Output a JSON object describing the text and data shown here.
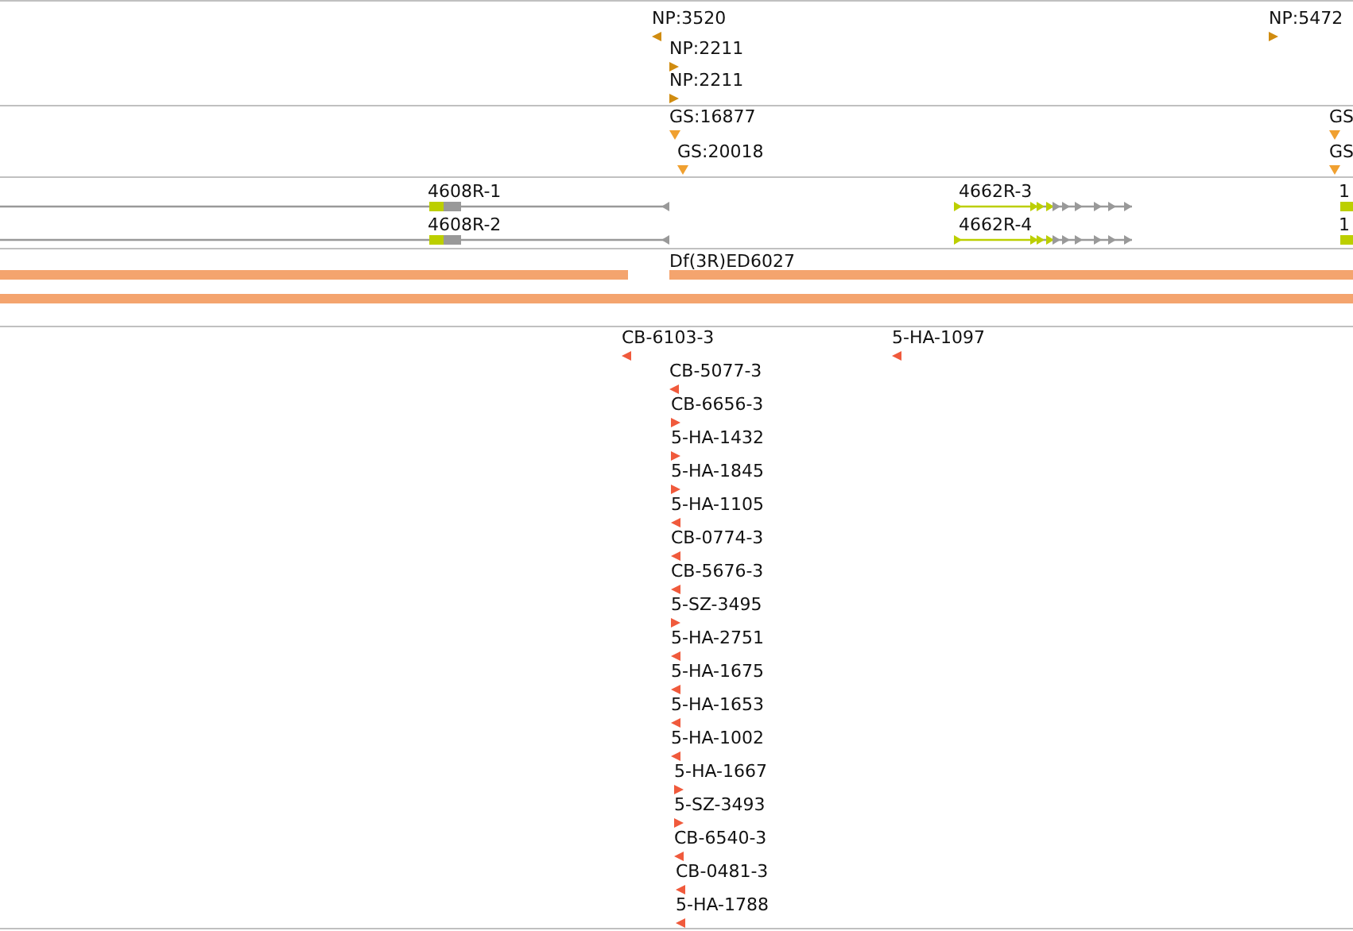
{
  "tracks": {
    "np": [
      {
        "label": "NP:3520",
        "kind": "reverse"
      },
      {
        "label": "NP:2211",
        "kind": "forward"
      },
      {
        "label": "NP:2211",
        "kind": "forward"
      },
      {
        "label": "NP:5472",
        "kind": "forward"
      }
    ],
    "gs": [
      {
        "label": "GS:16877",
        "kind": "down"
      },
      {
        "label": "GS:20018",
        "kind": "down"
      },
      {
        "label": "GS",
        "kind": "down"
      },
      {
        "label": "GS",
        "kind": "down"
      }
    ],
    "transcripts": [
      {
        "label": "4608R-1",
        "kind": "reverse"
      },
      {
        "label": "4608R-2",
        "kind": "reverse"
      },
      {
        "label": "4662R-3",
        "kind": "forward"
      },
      {
        "label": "4662R-4",
        "kind": "forward"
      },
      {
        "label": "1",
        "kind": "forward"
      },
      {
        "label": "1",
        "kind": "forward"
      }
    ],
    "deficiency": {
      "label": "Df(3R)ED6027"
    },
    "insertions": [
      {
        "label": "CB-6103-3",
        "kind": "reverse"
      },
      {
        "label": "5-HA-1097",
        "kind": "reverse"
      },
      {
        "label": "CB-5077-3",
        "kind": "reverse"
      },
      {
        "label": "CB-6656-3",
        "kind": "forward"
      },
      {
        "label": "5-HA-1432",
        "kind": "forward"
      },
      {
        "label": "5-HA-1845",
        "kind": "forward"
      },
      {
        "label": "5-HA-1105",
        "kind": "reverse"
      },
      {
        "label": "CB-0774-3",
        "kind": "reverse"
      },
      {
        "label": "CB-5676-3",
        "kind": "reverse"
      },
      {
        "label": "5-SZ-3495",
        "kind": "forward"
      },
      {
        "label": "5-HA-2751",
        "kind": "reverse"
      },
      {
        "label": "5-HA-1675",
        "kind": "reverse"
      },
      {
        "label": "5-HA-1653",
        "kind": "reverse"
      },
      {
        "label": "5-HA-1002",
        "kind": "reverse"
      },
      {
        "label": "5-HA-1667",
        "kind": "forward"
      },
      {
        "label": "5-SZ-3493",
        "kind": "forward"
      },
      {
        "label": "CB-6540-3",
        "kind": "reverse"
      },
      {
        "label": "CB-0481-3",
        "kind": "reverse"
      },
      {
        "label": "5-HA-1788",
        "kind": "reverse"
      }
    ]
  }
}
